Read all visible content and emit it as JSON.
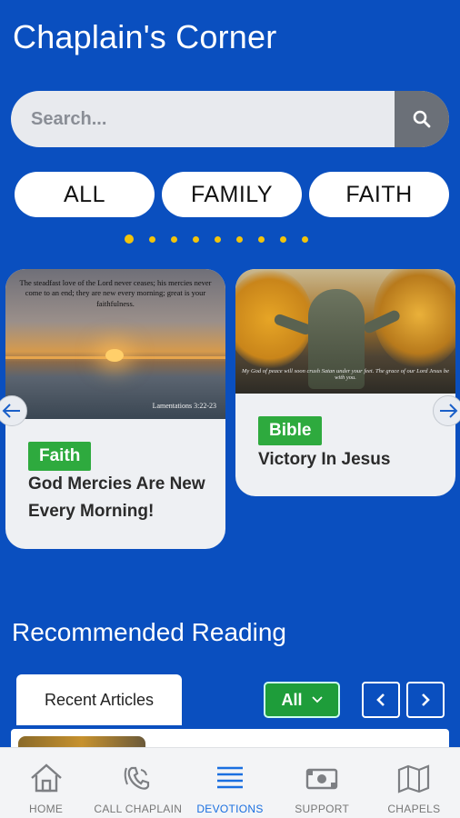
{
  "header": {
    "title": "Chaplain's Corner"
  },
  "search": {
    "placeholder": "Search..."
  },
  "filters": [
    "ALL",
    "FAMILY",
    "FAITH"
  ],
  "carousel": {
    "dot_count": 9,
    "active_index": 0,
    "cards": [
      {
        "image_quote": "The steadfast love of the Lord never ceases; his mercies never come to an end; they are new every morning; great is your faithfulness.",
        "image_reference": "Lamentations 3:22-23",
        "tag": "Faith",
        "title": "God Mercies Are New Every Morning!"
      },
      {
        "image_caption": "My God of peace will soon crush Satan under your feet. The grace of our Lord Jesus be with you.",
        "tag": "Bible",
        "title": "Victory In Jesus"
      }
    ]
  },
  "recommended": {
    "title": "Recommended Reading",
    "tab_label": "Recent Articles",
    "dropdown_value": "All"
  },
  "bottom_nav": {
    "items": [
      {
        "label": "HOME",
        "icon": "home-icon"
      },
      {
        "label": "CALL CHAPLAIN",
        "icon": "phone-icon"
      },
      {
        "label": "DEVOTIONS",
        "icon": "list-icon"
      },
      {
        "label": "SUPPORT",
        "icon": "money-icon"
      },
      {
        "label": "CHAPELS",
        "icon": "map-icon"
      }
    ],
    "active_index": 2
  },
  "colors": {
    "background": "#0a4fbf",
    "accent_yellow": "#f2c40c",
    "tag_green": "#2eaa3e",
    "active_nav": "#1a6fe0"
  }
}
